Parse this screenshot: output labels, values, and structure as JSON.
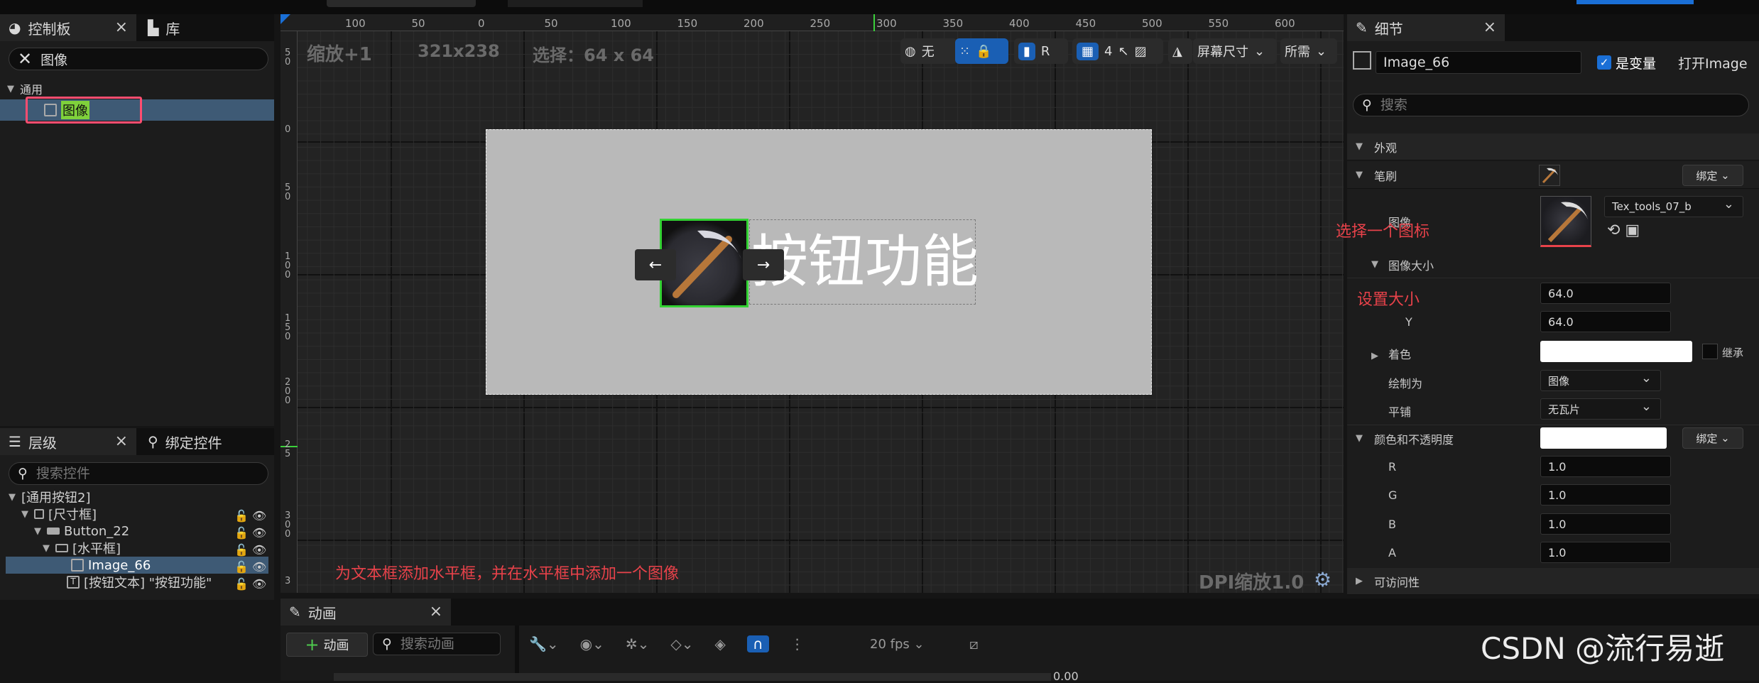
{
  "palette": {
    "title": "控制板",
    "library": "库",
    "search_value": "图像",
    "category": "通用",
    "item": "图像"
  },
  "hierarchy": {
    "title": "层级",
    "bind_tab": "绑定控件",
    "search_placeholder": "搜索控件",
    "items": [
      "[通用按钮2]",
      "[尺寸框]",
      "Button_22",
      "[水平框]",
      "Image_66",
      "[按钮文本] \"按钮功能\""
    ]
  },
  "viewport": {
    "zoom": "缩放+1",
    "size": "321x238",
    "selection": "选择：64 x 64",
    "world_label": "无",
    "r_label": "R",
    "grid_num": "4",
    "screen_size": "屏幕尺寸",
    "needed": "所需",
    "button_text": "按钮功能",
    "arrow_left": "←",
    "arrow_right": "→",
    "dpi": "DPI缩放1.0",
    "ruler_top": [
      "100",
      "50",
      "0",
      "50",
      "100",
      "150",
      "200",
      "250",
      "300",
      "350",
      "400",
      "450",
      "500",
      "550",
      "600"
    ],
    "ruler_left": [
      "5\n0",
      "0",
      "5\n0",
      "1\n0\n0",
      "1\n5\n0",
      "2\n0\n0",
      "2\n5",
      "3\n0\n0",
      "3"
    ],
    "annotation": "为文本框添加水平框，并在水平框中添加一个图像"
  },
  "details": {
    "title": "细节",
    "name": "Image_66",
    "is_variable": "是变量",
    "open": "打开Image",
    "search_placeholder": "搜索",
    "sections": {
      "appearance": "外观",
      "brush": "笔刷",
      "image": "图像",
      "image_size": "图像大小",
      "tint": "着色",
      "draw_as": "绘制为",
      "tiling": "平铺",
      "color_opacity": "颜色和不透明度",
      "accessibility": "可访问性"
    },
    "bind": "绑定",
    "texture": "Tex_tools_07_b",
    "size_x": "64.0",
    "size_y": "64.0",
    "y_label": "Y",
    "inherit": "继承",
    "draw_as_value": "图像",
    "tiling_value": "无瓦片",
    "r_label": "R",
    "g_label": "G",
    "b_label": "B",
    "a_label": "A",
    "r": "1.0",
    "g": "1.0",
    "b": "1.0",
    "a": "1.0",
    "note_icon": "选择一个图标",
    "note_size": "设置大小"
  },
  "animation": {
    "title": "动画",
    "add": "动画",
    "search_placeholder": "搜索动画",
    "fps": "20 fps",
    "time": "0.00"
  },
  "watermark": "CSDN @流行易逝"
}
